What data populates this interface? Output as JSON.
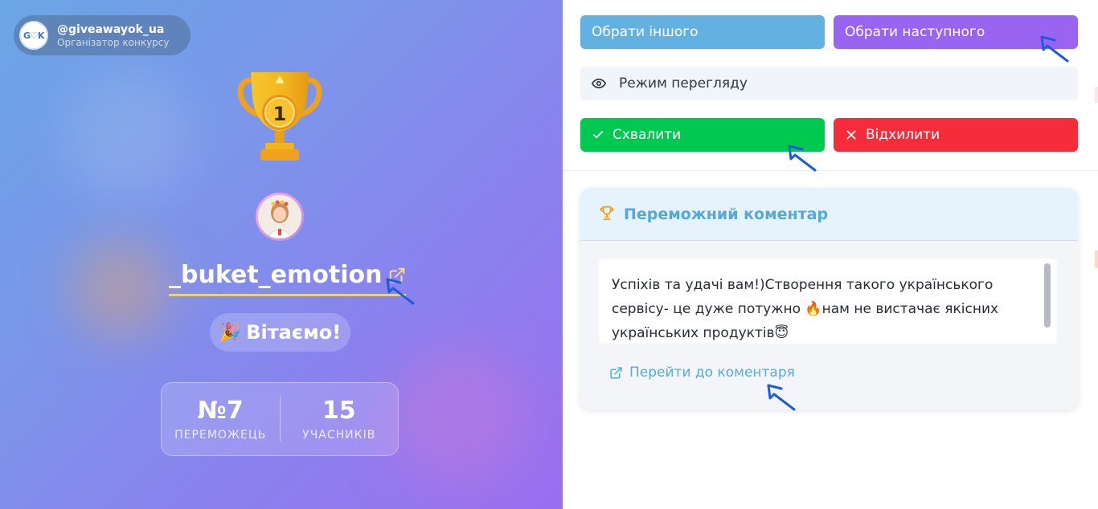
{
  "organizer": {
    "logo_text": "G♡K",
    "handle": "@giveawayok_ua",
    "role": "Організатор конкурсу"
  },
  "trophy": {
    "place": "1"
  },
  "winner": {
    "username": "_buket_emotion",
    "congrats": "Вітаємо!"
  },
  "stats": {
    "winner_number": "№7",
    "winner_label": "ПЕРЕМОЖЕЦЬ",
    "participants": "15",
    "participants_label": "УЧАСНИКІВ"
  },
  "actions": {
    "choose_other": "Обрати іншого",
    "choose_next": "Обрати наступного",
    "view_mode": "Режим перегляду",
    "approve": "Схвалити",
    "reject": "Відхилити"
  },
  "comment_card": {
    "title": "Переможний коментар",
    "comment": "Успіхів та удачі вам!)Створення такого українського сервісу- це дуже потужно 🔥нам не вистачає якісних українських продуктів😇",
    "link": "Перейти до коментаря"
  },
  "colors": {
    "choose_other": "#63b1e0",
    "choose_next": "#9a64f3",
    "approve": "#00c94f",
    "reject": "#f72c3a",
    "accent": "#55a8da"
  },
  "icons": [
    "trophy-icon",
    "external-link-icon",
    "party-popper-icon",
    "eye-icon",
    "check-icon",
    "close-icon",
    "cursor-arrow-icon"
  ]
}
